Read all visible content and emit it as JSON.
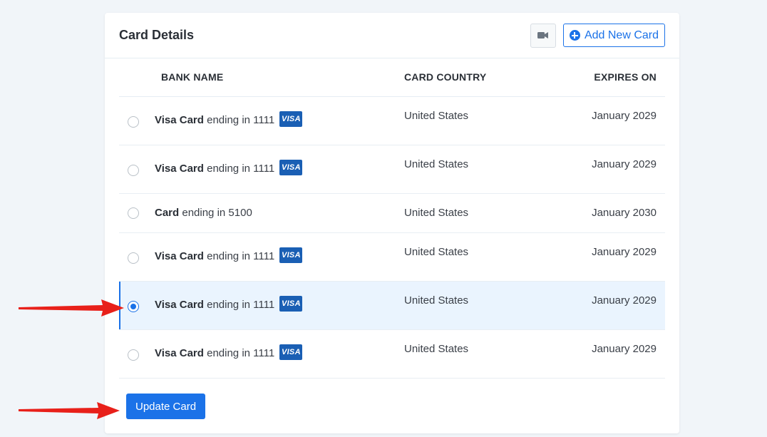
{
  "panel": {
    "title": "Card Details",
    "add_card_label": "Add New Card"
  },
  "table": {
    "headers": {
      "bank_name": "BANK NAME",
      "card_country": "CARD COUNTRY",
      "expires_on": "EXPIRES ON"
    },
    "rows": [
      {
        "brand": "Visa Card",
        "suffix": "ending in 1111",
        "badge": "VISA",
        "country": "United States",
        "expires": "January 2029",
        "selected": false
      },
      {
        "brand": "Visa Card",
        "suffix": "ending in 1111",
        "badge": "VISA",
        "country": "United States",
        "expires": "January 2029",
        "selected": false
      },
      {
        "brand": "Card",
        "suffix": "ending in 5100",
        "badge": "",
        "country": "United States",
        "expires": "January 2030",
        "selected": false
      },
      {
        "brand": "Visa Card",
        "suffix": "ending in 1111",
        "badge": "VISA",
        "country": "United States",
        "expires": "January 2029",
        "selected": false
      },
      {
        "brand": "Visa Card",
        "suffix": "ending in 1111",
        "badge": "VISA",
        "country": "United States",
        "expires": "January 2029",
        "selected": true
      },
      {
        "brand": "Visa Card",
        "suffix": "ending in 1111",
        "badge": "VISA",
        "country": "United States",
        "expires": "January 2029",
        "selected": false
      }
    ]
  },
  "footer": {
    "update_label": "Update Card"
  },
  "colors": {
    "accent": "#1b72e8",
    "selected_row": "#eaf4fe",
    "visa_badge": "#1a5fb4",
    "annotation_arrow": "#e8201a",
    "page_background": "#f1f5f9"
  },
  "icons": {
    "video": "video-camera-icon",
    "add": "plus-circle-icon",
    "annotation": "red-arrow-icon"
  }
}
